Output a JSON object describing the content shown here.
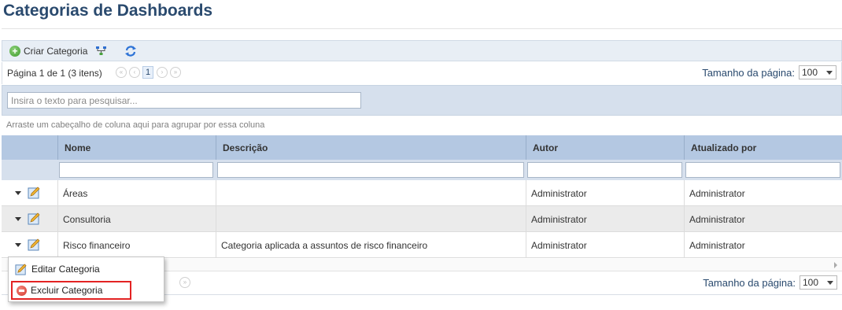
{
  "page": {
    "title": "Categorias de Dashboards"
  },
  "toolbar": {
    "create_label": "Criar Categoria",
    "icons": [
      "circle-plus-icon",
      "hierarchy-icon",
      "refresh-icon"
    ]
  },
  "pager": {
    "info": "Página 1 de 1 (3 itens)",
    "current_page": "1",
    "page_size_label": "Tamanho da página:",
    "page_size_value": "100"
  },
  "search": {
    "placeholder": "Insira o texto para pesquisar..."
  },
  "grid": {
    "group_hint": "Arraste um cabeçalho de coluna aqui para agrupar por essa coluna",
    "columns": [
      "Nome",
      "Descrição",
      "Autor",
      "Atualizado por"
    ],
    "rows": [
      {
        "nome": "Áreas",
        "descricao": "",
        "autor": "Administrator",
        "atualizado": "Administrator"
      },
      {
        "nome": "Consultoria",
        "descricao": "",
        "autor": "Administrator",
        "atualizado": "Administrator"
      },
      {
        "nome": "Risco financeiro",
        "descricao": "Categoria aplicada a assuntos de risco financeiro",
        "autor": "Administrator",
        "atualizado": "Administrator"
      }
    ]
  },
  "context_menu": {
    "items": [
      {
        "label": "Editar Categoria",
        "icon": "edit-icon"
      },
      {
        "label": "Excluir Categoria",
        "icon": "delete-icon",
        "highlight_color": "#e32323"
      }
    ]
  },
  "colors": {
    "title": "#2a4a6e",
    "header_bg": "#b4c8e2",
    "band_bg": "#d6e0ed",
    "alt_row": "#ebebeb"
  }
}
